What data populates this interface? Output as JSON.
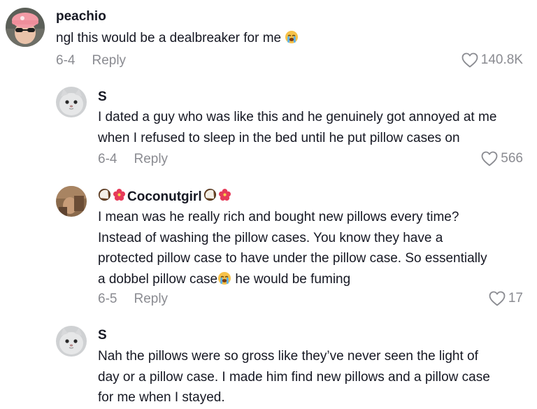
{
  "comments": [
    {
      "username": "peachio",
      "lines": [
        "ngl this would be a dealbreaker for me"
      ],
      "date": "6-4",
      "reply": "Reply",
      "likes": "140.8K"
    },
    {
      "username": "S",
      "lines": [
        "I dated a guy who was like this and he genuinely got annoyed at me",
        "when I refused to sleep in the bed until he put pillow cases on"
      ],
      "date": "6-4",
      "reply": "Reply",
      "likes": "566"
    },
    {
      "username": "Coconutgirl",
      "lines": [
        "I mean was he really rich and bought new pillows every time?",
        "Instead of washing the pillow cases. You know they have a",
        "protected pillow case to have under the pillow case. So essentially"
      ],
      "line4_a": "a dobbel pillow case",
      "line4_b": " he would be fuming",
      "date": "6-5",
      "reply": "Reply",
      "likes": "17"
    },
    {
      "username": "S",
      "lines": [
        "Nah the pillows were so gross like they’ve never seen the light of",
        "day or a pillow case. I made him find new pillows and a pillow case",
        "for me when I stayed."
      ]
    }
  ],
  "icons": {
    "like": "heart-outline-icon",
    "crying": "loudly-crying-face-emoji",
    "coconut": "coconut-emoji",
    "hibiscus": "hibiscus-emoji"
  },
  "colors": {
    "text": "#161823",
    "muted": "#8a8b91"
  }
}
